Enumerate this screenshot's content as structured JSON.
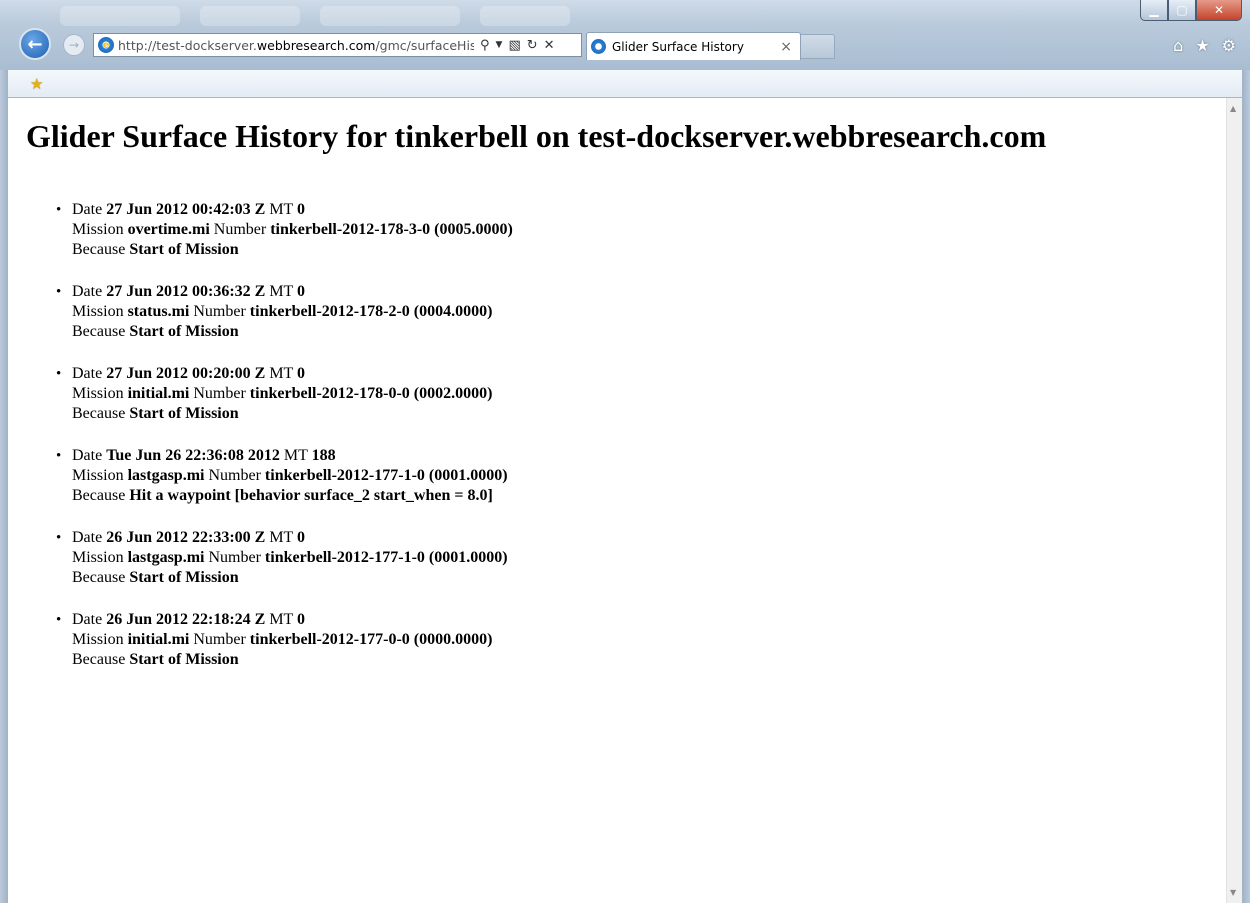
{
  "browser": {
    "url_prefix": "http://test-dockserver.",
    "url_host": "webbresearch.com",
    "url_suffix": "/gmc/surfaceHistory.p",
    "tab_title": "Glider Surface History"
  },
  "page": {
    "title": "Glider Surface History for tinkerbell on test-dockserver.webbresearch.com"
  },
  "labels": {
    "date": "Date",
    "mt": "MT",
    "mission": "Mission",
    "number": "Number",
    "because": "Because"
  },
  "entries": [
    {
      "date": "27 Jun 2012 00:42:03 Z",
      "mt": "0",
      "mission": "overtime.mi",
      "number": "tinkerbell-2012-178-3-0 (0005.0000)",
      "because": "Start of Mission"
    },
    {
      "date": "27 Jun 2012 00:36:32 Z",
      "mt": "0",
      "mission": "status.mi",
      "number": "tinkerbell-2012-178-2-0 (0004.0000)",
      "because": "Start of Mission"
    },
    {
      "date": "27 Jun 2012 00:20:00 Z",
      "mt": "0",
      "mission": "initial.mi",
      "number": "tinkerbell-2012-178-0-0 (0002.0000)",
      "because": "Start of Mission"
    },
    {
      "date": "Tue Jun 26 22:36:08 2012",
      "mt": "188",
      "mission": "lastgasp.mi",
      "number": "tinkerbell-2012-177-1-0 (0001.0000)",
      "because": "Hit a waypoint [behavior surface_2 start_when = 8.0]"
    },
    {
      "date": "26 Jun 2012 22:33:00 Z",
      "mt": "0",
      "mission": "lastgasp.mi",
      "number": "tinkerbell-2012-177-1-0 (0001.0000)",
      "because": "Start of Mission"
    },
    {
      "date": "26 Jun 2012 22:18:24 Z",
      "mt": "0",
      "mission": "initial.mi",
      "number": "tinkerbell-2012-177-0-0 (0000.0000)",
      "because": "Start of Mission"
    }
  ]
}
